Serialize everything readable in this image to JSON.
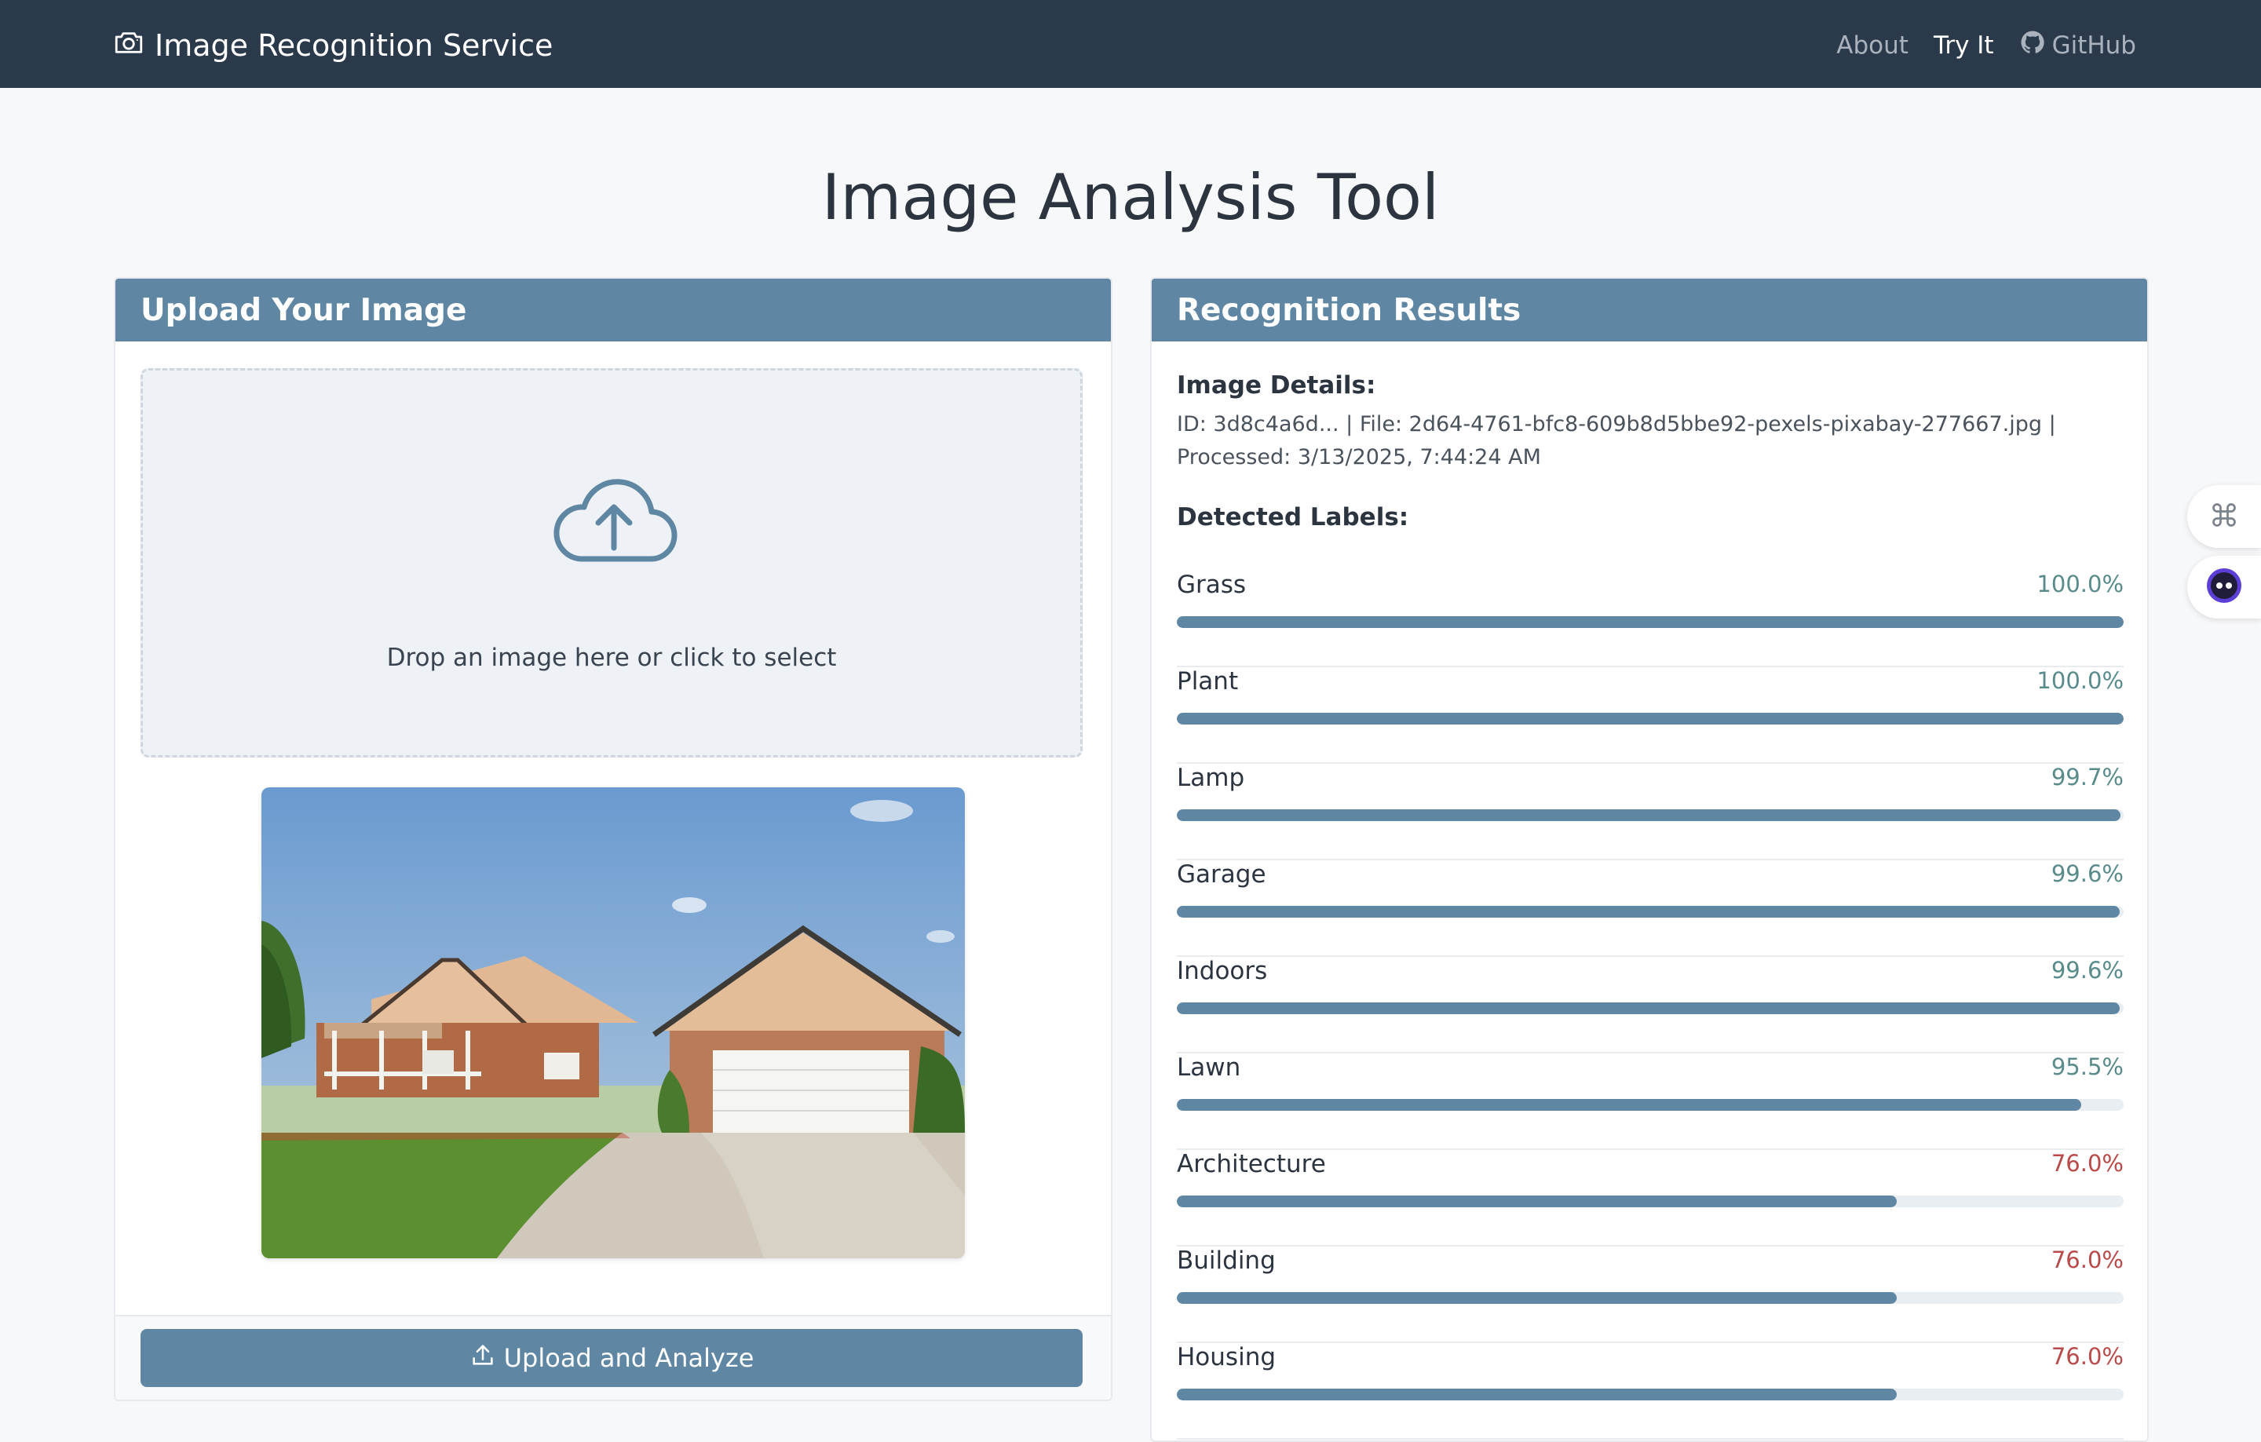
{
  "nav": {
    "brand": "Image Recognition Service",
    "links": [
      {
        "label": "About"
      },
      {
        "label": "Try It"
      },
      {
        "label": "GitHub"
      }
    ]
  },
  "page_title": "Image Analysis Tool",
  "upload": {
    "header": "Upload Your Image",
    "dropzone_text": "Drop an image here or click to select",
    "button_label": "Upload and Analyze"
  },
  "results": {
    "header": "Recognition Results",
    "details_heading": "Image Details:",
    "details_text": "ID: 3d8c4a6d... | File: 2d64-4761-bfc8-609b8d5bbe92-pexels-pixabay-277667.jpg | Processed: 3/13/2025, 7:44:24 AM",
    "labels_heading": "Detected Labels:",
    "labels": [
      {
        "name": "Grass",
        "percent": "100.0%",
        "value": 100.0
      },
      {
        "name": "Plant",
        "percent": "100.0%",
        "value": 100.0
      },
      {
        "name": "Lamp",
        "percent": "99.7%",
        "value": 99.7
      },
      {
        "name": "Garage",
        "percent": "99.6%",
        "value": 99.6
      },
      {
        "name": "Indoors",
        "percent": "99.6%",
        "value": 99.6
      },
      {
        "name": "Lawn",
        "percent": "95.5%",
        "value": 95.5
      },
      {
        "name": "Architecture",
        "percent": "76.0%",
        "value": 76.0
      },
      {
        "name": "Building",
        "percent": "76.0%",
        "value": 76.0
      },
      {
        "name": "Housing",
        "percent": "76.0%",
        "value": 76.0
      }
    ]
  },
  "colors": {
    "navbar": "#2b3a4a",
    "accent": "#5f87a3",
    "high_confidence": "#5a8b8b",
    "mid_confidence": "#b84a4a"
  },
  "icons": [
    "camera-icon",
    "github-icon",
    "cloud-upload-icon",
    "upload-icon",
    "command-icon",
    "assistant-icon"
  ]
}
